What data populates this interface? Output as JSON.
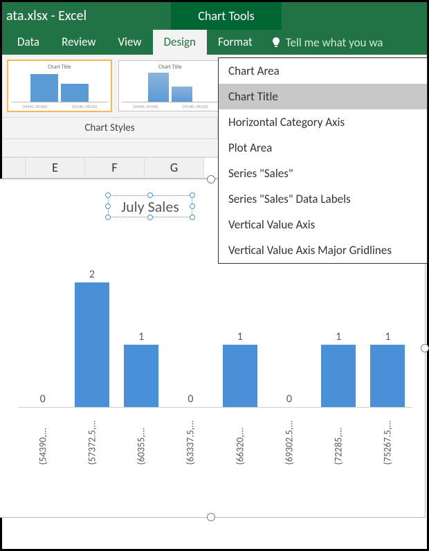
{
  "titlebar": {
    "filename": "ata.xlsx - Excel",
    "context_tab": "Chart Tools"
  },
  "ribbon": {
    "tabs": [
      "Data",
      "Review",
      "View",
      "Design",
      "Format"
    ],
    "active_tab": "Design",
    "tell_me": "Tell me what you wa",
    "group_label": "Chart Styles",
    "thumb_title": "Chart Title"
  },
  "dropdown": {
    "items": [
      "Chart Area",
      "Chart Title",
      "Horizontal Category Axis",
      "Plot Area",
      "Series \"Sales\"",
      "Series \"Sales\" Data Labels",
      "Vertical Value Axis",
      "Vertical Value Axis Major Gridlines"
    ],
    "hover_index": 1
  },
  "columns": [
    "E",
    "F",
    "G"
  ],
  "chart_title": "July Sales",
  "chart_data": {
    "type": "bar",
    "title": "July Sales",
    "xlabel": "",
    "ylabel": "",
    "ylim": [
      0,
      2
    ],
    "categories": [
      "(54390,...",
      "(57372.5,...",
      "(60355,...",
      "(63337.5,...",
      "(66320,...",
      "(69302.5,...",
      "(72285,...",
      "(75267.5,..."
    ],
    "values": [
      0,
      2,
      1,
      0,
      1,
      0,
      1,
      1
    ]
  }
}
